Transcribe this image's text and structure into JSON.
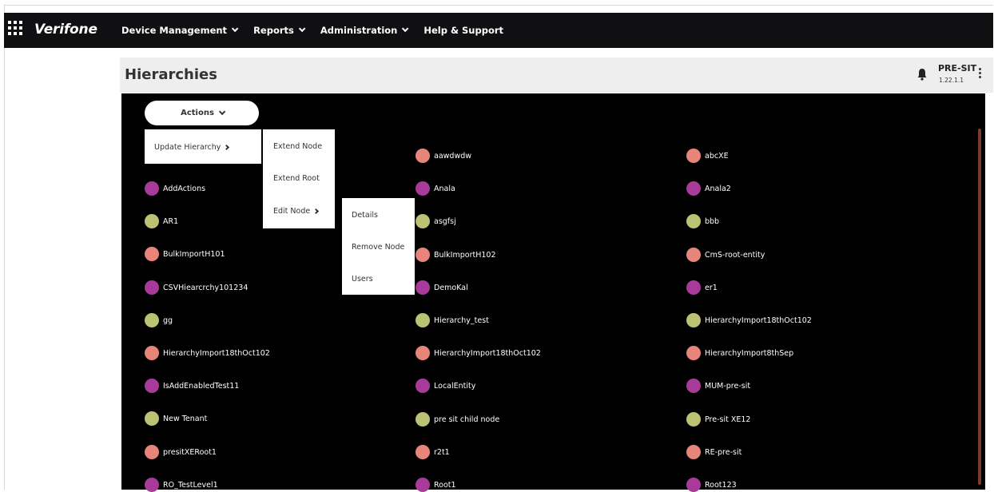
{
  "app": {
    "logo": "Verifone",
    "nav": [
      {
        "label": "Device Management",
        "dropdown": true
      },
      {
        "label": "Reports",
        "dropdown": true
      },
      {
        "label": "Administration",
        "dropdown": true
      },
      {
        "label": "Help & Support",
        "dropdown": false
      }
    ]
  },
  "header": {
    "title": "Hierarchies",
    "environment": "PRE-SIT",
    "version": "1.22.1.1"
  },
  "actions": {
    "label": "Actions",
    "menu": {
      "item": "Update Hierarchy",
      "submenu": [
        "Extend Node",
        "Extend Root",
        "Edit Node"
      ],
      "edit_submenu": [
        "Details",
        "Remove Node",
        "Users"
      ]
    }
  },
  "colors": {
    "salmon": "#e8857a",
    "purple": "#a83a99",
    "olive": "#bcc273",
    "topbar": "#101012"
  },
  "nodes": {
    "col1": [
      {
        "label": "AddActions",
        "color": "purple"
      },
      {
        "label": "AR1",
        "color": "olive"
      },
      {
        "label": "BulkImportH101",
        "color": "salmon"
      },
      {
        "label": "CSVHiearcrchy101234",
        "color": "purple"
      },
      {
        "label": "gg",
        "color": "olive"
      },
      {
        "label": "HierarchyImport18thOct102",
        "color": "salmon"
      },
      {
        "label": "IsAddEnabledTest11",
        "color": "purple"
      },
      {
        "label": "New Tenant",
        "color": "olive"
      },
      {
        "label": "presitXERoot1",
        "color": "salmon"
      },
      {
        "label": "RO_TestLevel1",
        "color": "purple"
      }
    ],
    "col2": [
      {
        "label": "aawdwdw",
        "color": "salmon"
      },
      {
        "label": "Anala",
        "color": "purple"
      },
      {
        "label": "asgfsj",
        "color": "olive"
      },
      {
        "label": "BulkImportH102",
        "color": "salmon"
      },
      {
        "label": "DemoKal",
        "color": "purple"
      },
      {
        "label": "Hierarchy_test",
        "color": "olive"
      },
      {
        "label": "HierarchyImport18thOct102",
        "color": "salmon"
      },
      {
        "label": "LocalEntity",
        "color": "purple"
      },
      {
        "label": "pre sit child node",
        "color": "olive"
      },
      {
        "label": "r2t1",
        "color": "salmon"
      },
      {
        "label": "Root1",
        "color": "purple"
      }
    ],
    "col3": [
      {
        "label": "abcXE",
        "color": "salmon"
      },
      {
        "label": "Anala2",
        "color": "purple"
      },
      {
        "label": "bbb",
        "color": "olive"
      },
      {
        "label": "CmS-root-entity",
        "color": "salmon"
      },
      {
        "label": "er1",
        "color": "purple"
      },
      {
        "label": "HierarchyImport18thOct102",
        "color": "olive"
      },
      {
        "label": "HierarchyImport8thSep",
        "color": "salmon"
      },
      {
        "label": "MUM-pre-sit",
        "color": "purple"
      },
      {
        "label": "Pre-sit XE12",
        "color": "olive"
      },
      {
        "label": "RE-pre-sit",
        "color": "salmon"
      },
      {
        "label": "Root123",
        "color": "purple"
      }
    ]
  }
}
